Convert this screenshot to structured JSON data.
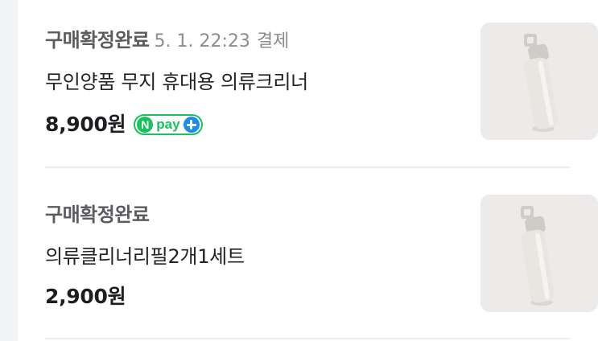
{
  "orders": [
    {
      "status": "구매확정완료",
      "date": "5. 1. 22:23",
      "payment_label": "결제",
      "product_name": "무인양품 무지 휴대용 의류크리너",
      "price": "8,900원",
      "npay": {
        "n": "N",
        "text": "pay",
        "plus_icon": "plus-icon"
      },
      "thumbnail_icon": "lint-roller-image"
    },
    {
      "status": "구매확정완료",
      "product_name": "의류클리너리필2개1세트",
      "price": "2,900원",
      "thumbnail_icon": "lint-roller-image"
    }
  ],
  "colors": {
    "status": "#5b5b60",
    "date": "#8b8b91",
    "npay_green": "#18c35c",
    "npay_blue": "#1a8cf0",
    "divider": "#ececef"
  }
}
